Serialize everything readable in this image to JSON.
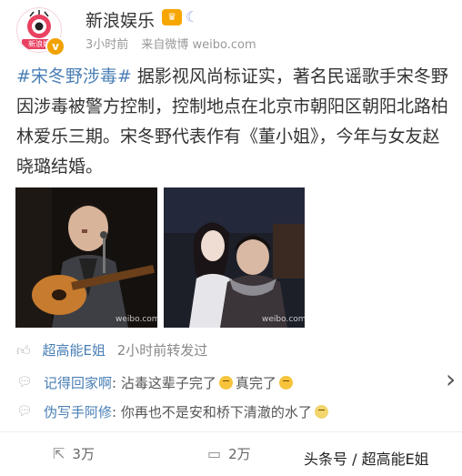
{
  "header": {
    "author": "新浪娱乐",
    "avatar_text": "新浪娱",
    "time": "3小时前",
    "source": "来自微博 weibo.com"
  },
  "post": {
    "hashtag": "#宋冬野涉毒#",
    "text": " 据影视风尚标证实，著名民谣歌手宋冬野因涉毒被警方控制，控制地点在北京市朝阳区朝阳北路柏林爱乐三期。宋冬野代表作有《董小姐》，今年与女友赵晓璐结婚。"
  },
  "images": {
    "watermark1": "weibo.com",
    "watermark2": "weibo.com"
  },
  "repost": {
    "name": "超高能E姐",
    "time": "2小时前转发过"
  },
  "comments": [
    {
      "name": "记得回家啊",
      "text": "沾毒这辈子完了",
      "tail": "真完了"
    },
    {
      "name": "伪写手阿修",
      "text": "你再也不是安和桥下清澈的水了"
    }
  ],
  "footer": {
    "reposts": "3万",
    "comments": "2万",
    "watermark": "头条号 / 超高能E姐"
  },
  "colors": {
    "link": "#4a7fb5",
    "verified": "#f1a200"
  }
}
